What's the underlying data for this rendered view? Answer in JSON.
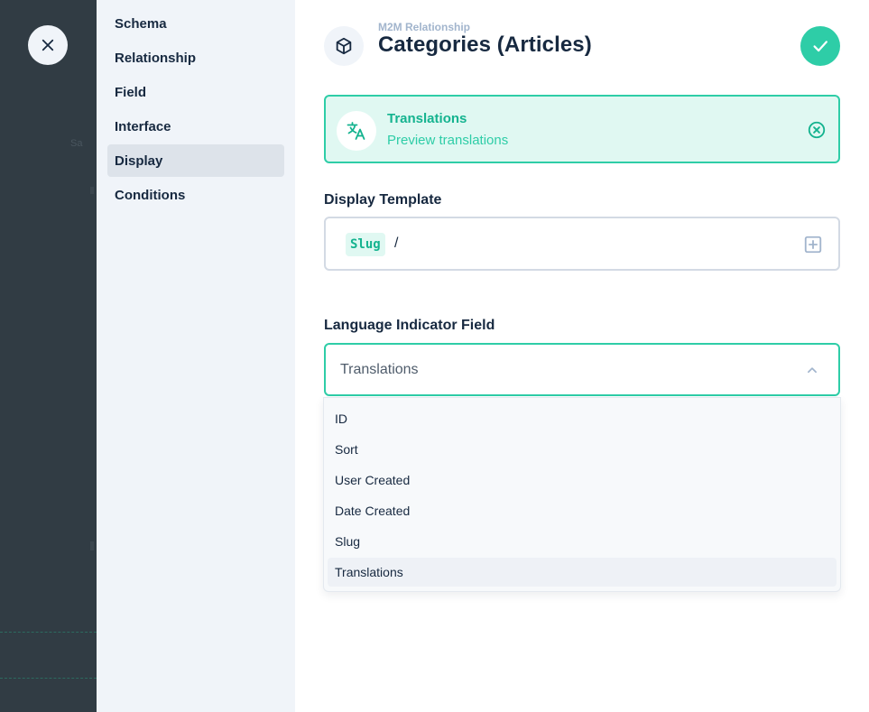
{
  "overlay": {
    "ghost_text": "Sa"
  },
  "nav": {
    "items": [
      {
        "label": "Schema"
      },
      {
        "label": "Relationship"
      },
      {
        "label": "Field"
      },
      {
        "label": "Interface"
      },
      {
        "label": "Display"
      },
      {
        "label": "Conditions"
      }
    ],
    "active_index": 4
  },
  "header": {
    "subtitle": "M2M Relationship",
    "title": "Categories (Articles)",
    "icon": "box-icon"
  },
  "notice": {
    "title": "Translations",
    "description": "Preview translations",
    "icon": "translate-icon"
  },
  "display_template": {
    "label": "Display Template",
    "chip": "Slug",
    "separator": "/"
  },
  "language_field": {
    "label": "Language Indicator Field",
    "selected": "Translations",
    "options": [
      "ID",
      "Sort",
      "User Created",
      "Date Created",
      "Slug",
      "Translations"
    ]
  },
  "colors": {
    "accent": "#2ecda7",
    "accent_dark": "#14b38f",
    "accent_bg": "#e0f8f2",
    "overlay": "#313c44",
    "nav_bg": "#f0f4f9",
    "text": "#172940"
  }
}
